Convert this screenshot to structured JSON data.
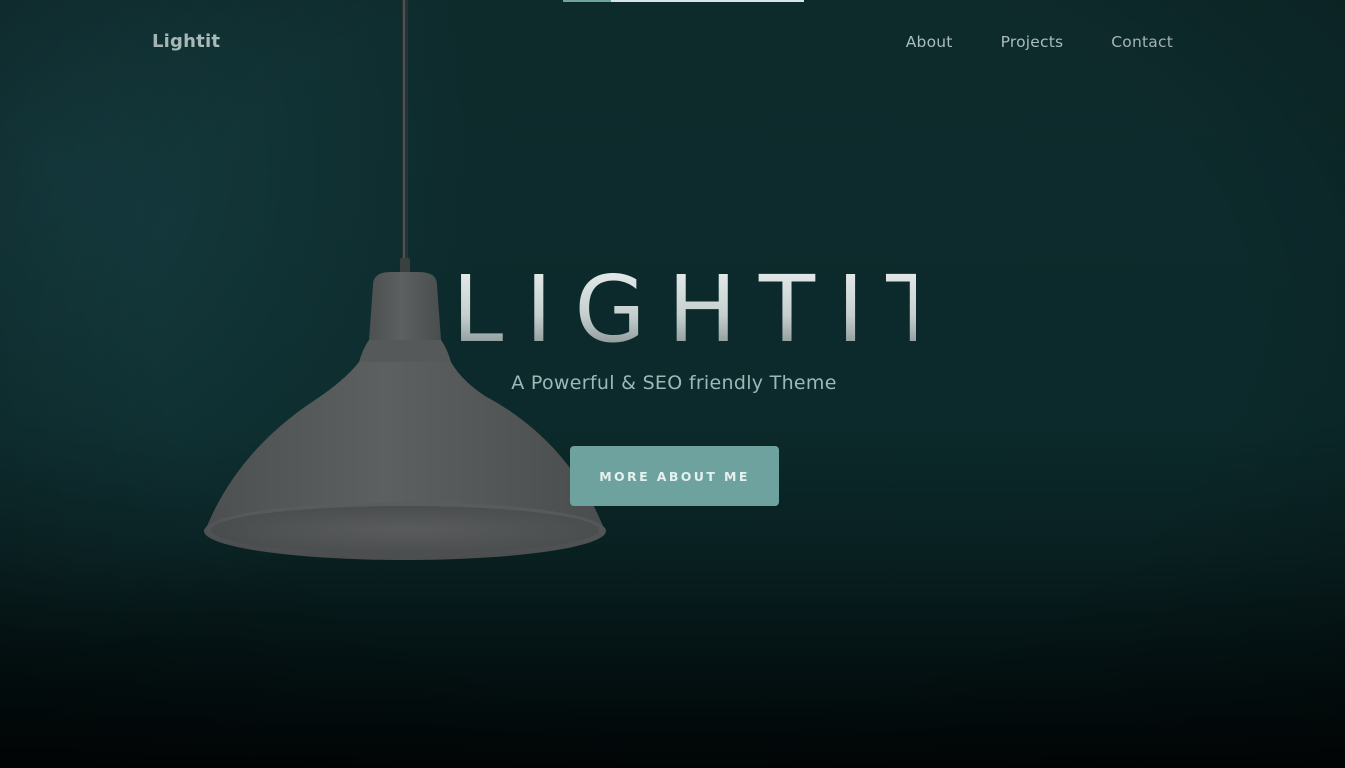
{
  "header": {
    "brand": "Lightit",
    "nav": [
      {
        "label": "About"
      },
      {
        "label": "Projects"
      },
      {
        "label": "Contact"
      }
    ]
  },
  "hero": {
    "title": "LIGHTIT",
    "subtitle": "A Powerful & SEO friendly Theme",
    "cta_label": "MORE ABOUT ME"
  },
  "colors": {
    "background": "#0c2829",
    "accent": "#6ea29f",
    "nav_text": "#a9bdbc",
    "lamp_shade": "#575a5b"
  },
  "icons": {
    "lamp": "pendant-lamp"
  }
}
